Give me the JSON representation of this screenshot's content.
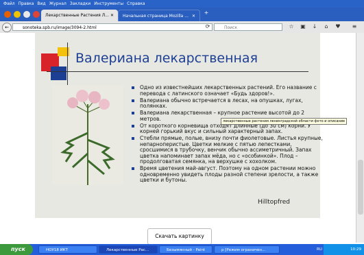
{
  "menu": [
    "Файл",
    "Правка",
    "Вид",
    "Журнал",
    "Закладки",
    "Инструменты",
    "Справка"
  ],
  "tabs": [
    {
      "label": "Лекарственные Растения Л...",
      "active": true
    },
    {
      "label": "Начальная страница Mozilla ...",
      "active": false
    }
  ],
  "nav": {
    "url": "sonoteka.spb.ru/image/3094-2.html",
    "search_placeholder": "Поиск"
  },
  "page": {
    "title": "Валериана лекарственная",
    "bullets": [
      "Одно из известнейших лекарственных растений. Его название с перевода с латинского означает «Будь здоров!».",
      "Валериана обычно встречается в лесах, на опушках, лугах, полянках.",
      "Валериана лекарственная – крупное растение высотой до 2 метров.",
      "От короткого корневища отходят длинные (до 30 см) корни. У корней горький вкус и сильный характерный запах.",
      "Стебли прямые, полые, внизу почти фиолетовые. Листья крупные, непарноперистые. Цветки мелкие с пятью лепестками, сросшимися в трубочку, венчик обычно ассиметричный. Запах цветка напоминает запах мёда, но с «особинкой». Плод – продолговатая семянка, на верхушке с хохолком.",
      "Время цветения май-август. Поэтому на одном растении можно одновременно увидеть плоды разной степени зрелости, а также цветки и бутоны."
    ],
    "tooltip": "лекарственные растения ленинградской области фото и описание",
    "watermark": "Hilltopfred",
    "download_label": "Скачать картинку"
  },
  "taskbar": {
    "start": "пуск",
    "tasks": [
      "НОУ18 ИКТ",
      "Лекарственные Рас...",
      "Безымянный - Paint",
      "р [Режим ограничен..."
    ],
    "lang": "RU",
    "time": "10:29"
  },
  "colors": {
    "title": "#1c3f94",
    "panel": "#e8e8e2",
    "taskbar": "#245edb",
    "start": "#3c9a3c"
  }
}
